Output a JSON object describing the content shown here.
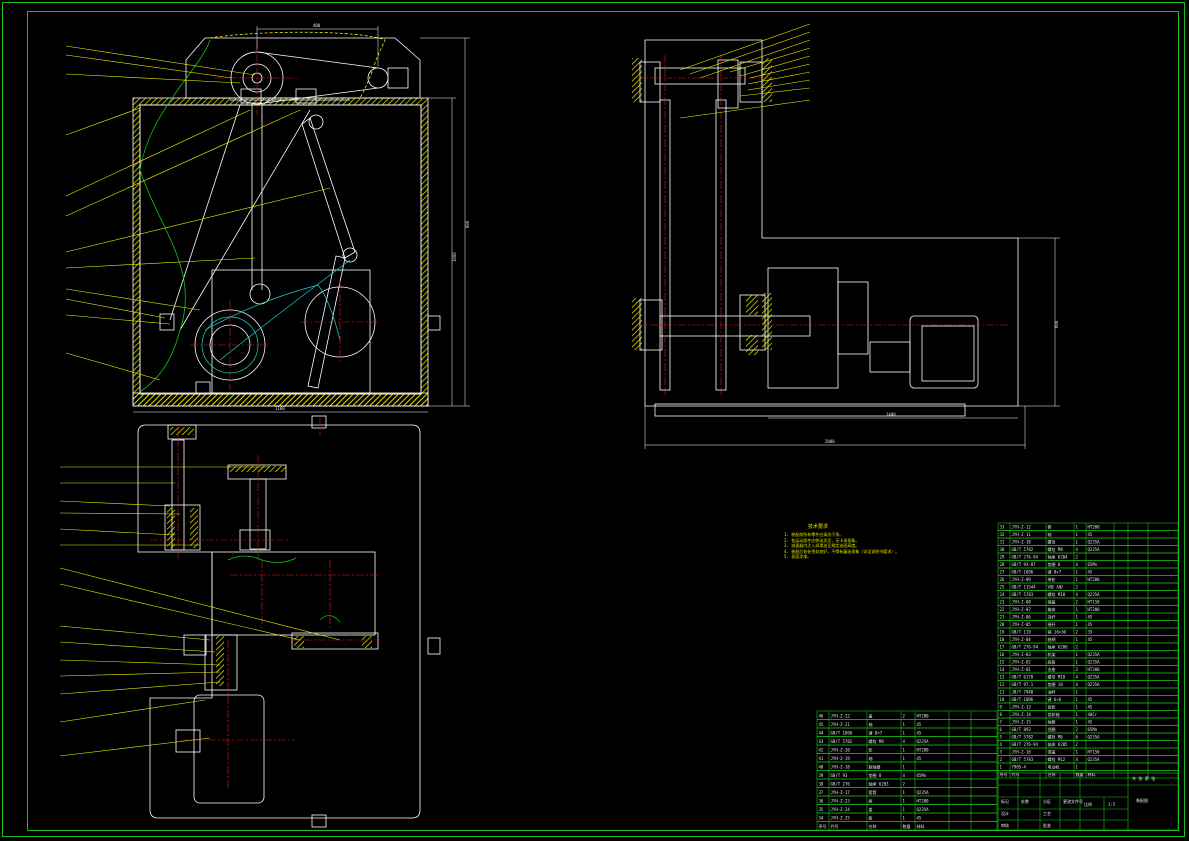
{
  "drawing": {
    "title": "",
    "colors": {
      "background": "#000000",
      "frame": "#18c018",
      "outline": "#ffffff",
      "hatch": "#f0f000",
      "leader": "#f0f000",
      "centerline": "#e01818",
      "hidden": "#20d0d0"
    }
  },
  "notes": {
    "heading": "技术要求",
    "lines": [
      "1. 装配前所有零件应清洗干净。",
      "2. 各运动部件应转动灵活，无卡滞现象。",
      "3. 减速器内注入润滑油至规定油面高度。",
      "4. 装配后各处密封良好，不得有漏油现象（详见说明书要求）。",
      "5. 表面涂漆。"
    ]
  },
  "dimensions": {
    "front_top": "400",
    "front_height": "800",
    "front_height_inner": "1000",
    "front_width": "1100",
    "side_height": "600",
    "side_inner": "500",
    "side_len1": "1400",
    "side_len2": "2000"
  },
  "bom": {
    "right_rows": [
      [
        "33",
        "JYH-Z-12",
        "套",
        "1",
        "HT200"
      ],
      [
        "32",
        "JYH-Z-11",
        "轴",
        "1",
        "45"
      ],
      [
        "31",
        "JYH-Z-10",
        "螺母",
        "1",
        "Q235A"
      ],
      [
        "30",
        "GB/T 5782",
        "螺栓 M8",
        "4",
        "Q235A"
      ],
      [
        "29",
        "GB/T 276-94",
        "轴承 6204",
        "2",
        ""
      ],
      [
        "28",
        "GB/T 93-87",
        "垫圈 8",
        "4",
        "65Mn"
      ],
      [
        "27",
        "GB/T 1096",
        "键 8×7",
        "1",
        "45"
      ],
      [
        "26",
        "JYH-Z-09",
        "带轮",
        "1",
        "HT200"
      ],
      [
        "25",
        "GB/T 11544",
        "V带 A型",
        "2",
        ""
      ],
      [
        "24",
        "GB/T 5783",
        "螺栓 M10",
        "4",
        "Q235A"
      ],
      [
        "23",
        "JYH-Z-08",
        "端盖",
        "2",
        "HT150"
      ],
      [
        "22",
        "JYH-Z-07",
        "箱体",
        "1",
        "HT200"
      ],
      [
        "21",
        "JYH-Z-06",
        "连杆",
        "1",
        "45"
      ],
      [
        "20",
        "JYH-Z-05",
        "摇杆",
        "1",
        "45"
      ],
      [
        "19",
        "GB/T 119",
        "销 10×30",
        "2",
        "35"
      ],
      [
        "18",
        "JYH-Z-04",
        "曲柄",
        "1",
        "45"
      ],
      [
        "17",
        "GB/T 276-94",
        "轴承 6206",
        "2",
        ""
      ],
      [
        "16",
        "JYH-Z-03",
        "机架",
        "1",
        "Q235A"
      ],
      [
        "15",
        "JYH-Z-02",
        "底板",
        "1",
        "Q235A"
      ],
      [
        "14",
        "JYH-Z-01",
        "支座",
        "2",
        "HT200"
      ],
      [
        "13",
        "GB/T 6170",
        "螺母 M10",
        "4",
        "Q235A"
      ],
      [
        "12",
        "GB/T 97.1",
        "垫圈 10",
        "4",
        "Q235A"
      ],
      [
        "11",
        "JB/T 7940",
        "油杯",
        "1",
        ""
      ],
      [
        "10",
        "GB/T 1096",
        "键 6×6",
        "1",
        "45"
      ],
      [
        "9",
        "JYH-Z-13",
        "齿轮",
        "1",
        "45"
      ],
      [
        "8",
        "JYH-Z-14",
        "齿轮轴",
        "1",
        "40Cr"
      ],
      [
        "7",
        "JYH-Z-15",
        "轴套",
        "1",
        "45"
      ],
      [
        "6",
        "GB/T 893",
        "挡圈",
        "2",
        "65Mn"
      ],
      [
        "5",
        "GB/T 5782",
        "螺栓 M6",
        "6",
        "Q235A"
      ],
      [
        "4",
        "GB/T 276-94",
        "轴承 6205",
        "2",
        ""
      ],
      [
        "3",
        "JYH-Z-16",
        "透盖",
        "1",
        "HT150"
      ],
      [
        "2",
        "GB/T 5783",
        "螺栓 M12",
        "4",
        "Q235A"
      ],
      [
        "1",
        "Y90S-4",
        "电动机",
        "1",
        ""
      ]
    ],
    "right_header": [
      "序号",
      "代号",
      "名称",
      "数量",
      "材料"
    ],
    "left_rows": [
      [
        "46",
        "JYH-Z-22",
        "盖",
        "2",
        "HT200"
      ],
      [
        "45",
        "JYH-Z-21",
        "轴",
        "1",
        "45"
      ],
      [
        "44",
        "GB/T 1096",
        "键 8×7",
        "1",
        "45"
      ],
      [
        "43",
        "GB/T 5782",
        "螺栓 M8",
        "4",
        "Q235A"
      ],
      [
        "42",
        "JYH-Z-20",
        "轮",
        "1",
        "HT200"
      ],
      [
        "41",
        "JYH-Z-19",
        "轴",
        "1",
        "45"
      ],
      [
        "40",
        "JYH-Z-18",
        "联轴器",
        "1",
        ""
      ],
      [
        "39",
        "GB/T 93",
        "垫圈 8",
        "4",
        "65Mn"
      ],
      [
        "38",
        "GB/T 276",
        "轴承 6203",
        "2",
        ""
      ],
      [
        "37",
        "JYH-Z-17",
        "套筒",
        "1",
        "Q235A"
      ],
      [
        "36",
        "JYH-Z-23",
        "座",
        "1",
        "HT200"
      ],
      [
        "35",
        "JYH-Z-24",
        "盖",
        "1",
        "Q235A"
      ],
      [
        "34",
        "JYH-Z-25",
        "板",
        "1",
        "45"
      ]
    ],
    "left_header": [
      "序号",
      "代号",
      "名称",
      "数量",
      "材料"
    ]
  },
  "title_block": {
    "drawing_name": "装配图",
    "scale_label": "比例",
    "scale": "1:5",
    "sheet_label": "共 张 第 张",
    "labels": [
      "标记",
      "处数",
      "分区",
      "更改文件号",
      "签名",
      "日期"
    ],
    "role_labels": [
      "设计",
      "审核",
      "工艺",
      "批准"
    ]
  }
}
